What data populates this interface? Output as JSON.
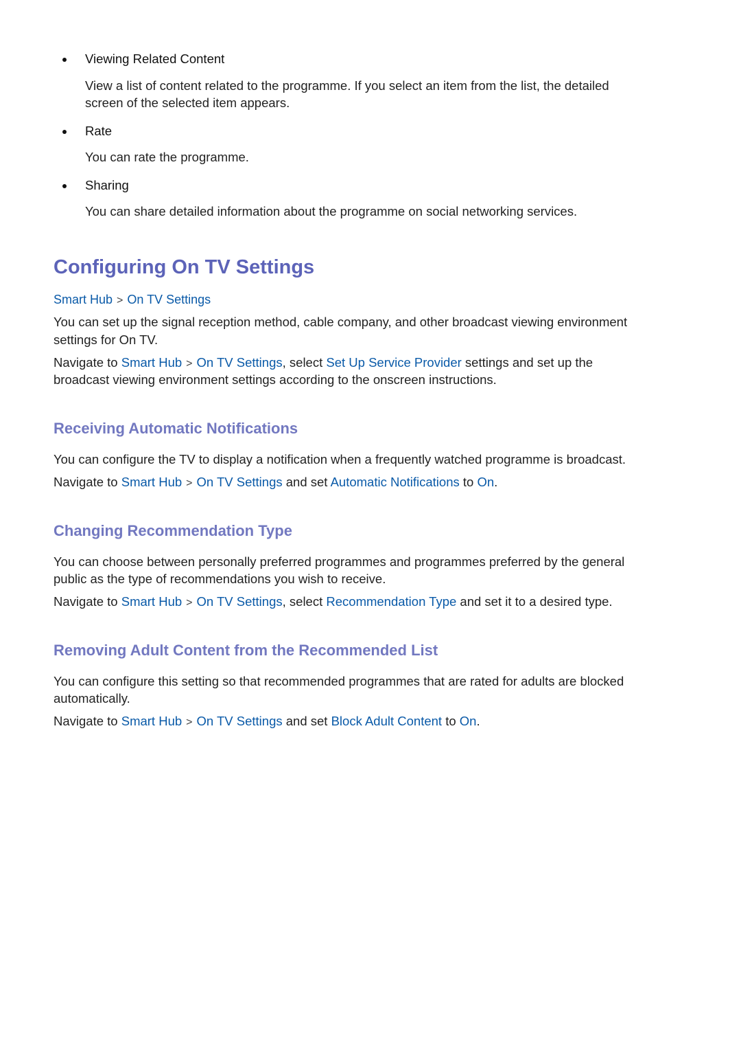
{
  "bullets": [
    {
      "title": "Viewing Related Content",
      "body_line1": "View a list of content related to the programme. If you select an item from the list, the detailed",
      "body_line2": "screen of the selected item appears."
    },
    {
      "title": "Rate",
      "body_line1": "You can rate the programme."
    },
    {
      "title": "Sharing",
      "body_line1": "You can share detailed information about the programme on social networking services."
    }
  ],
  "section": {
    "title": "Configuring On TV Settings",
    "breadcrumb": [
      "Smart Hub",
      "On TV Settings"
    ],
    "separator": ">",
    "intro_line1": "You can set up the signal reception method, cable company, and other broadcast viewing environment",
    "intro_line2": "settings for On TV.",
    "nav": {
      "prefix": "Navigate to ",
      "smart_hub": "Smart Hub",
      "on_tv": "On TV Settings",
      "mid": ", select ",
      "item": "Set Up Service Provider",
      "suffix": " settings and set up the",
      "line2": "broadcast viewing environment settings according to the onscreen instructions."
    }
  },
  "subsections": [
    {
      "title": "Receiving Automatic Notifications",
      "body": "You can configure the TV to display a notification when a frequently watched programme is broadcast.",
      "nav_prefix": "Navigate to ",
      "smart_hub": "Smart Hub",
      "on_tv": "On TV Settings",
      "mid": " and set ",
      "item": "Automatic Notifications",
      "to": " to ",
      "value": "On",
      "end": "."
    },
    {
      "title": "Changing Recommendation Type",
      "body_line1": "You can choose between personally preferred programmes and programmes preferred by the general",
      "body_line2": "public as the type of recommendations you wish to receive.",
      "nav_prefix": "Navigate to ",
      "smart_hub": "Smart Hub",
      "on_tv": "On TV Settings",
      "mid": ", select ",
      "item": "Recommendation Type",
      "suffix": " and set it to a desired type."
    },
    {
      "title": "Removing Adult Content from the Recommended List",
      "body_line1": "You can configure this setting so that recommended programmes that are rated for adults are blocked",
      "body_line2": "automatically.",
      "nav_prefix": "Navigate to ",
      "smart_hub": "Smart Hub",
      "on_tv": "On TV Settings",
      "mid": " and set ",
      "item": "Block Adult Content",
      "to": " to ",
      "value": "On",
      "end": "."
    }
  ],
  "colors": {
    "heading": "#5c63b8",
    "subheading": "#7278c0",
    "link": "#0a5aa8",
    "text": "#222222"
  }
}
